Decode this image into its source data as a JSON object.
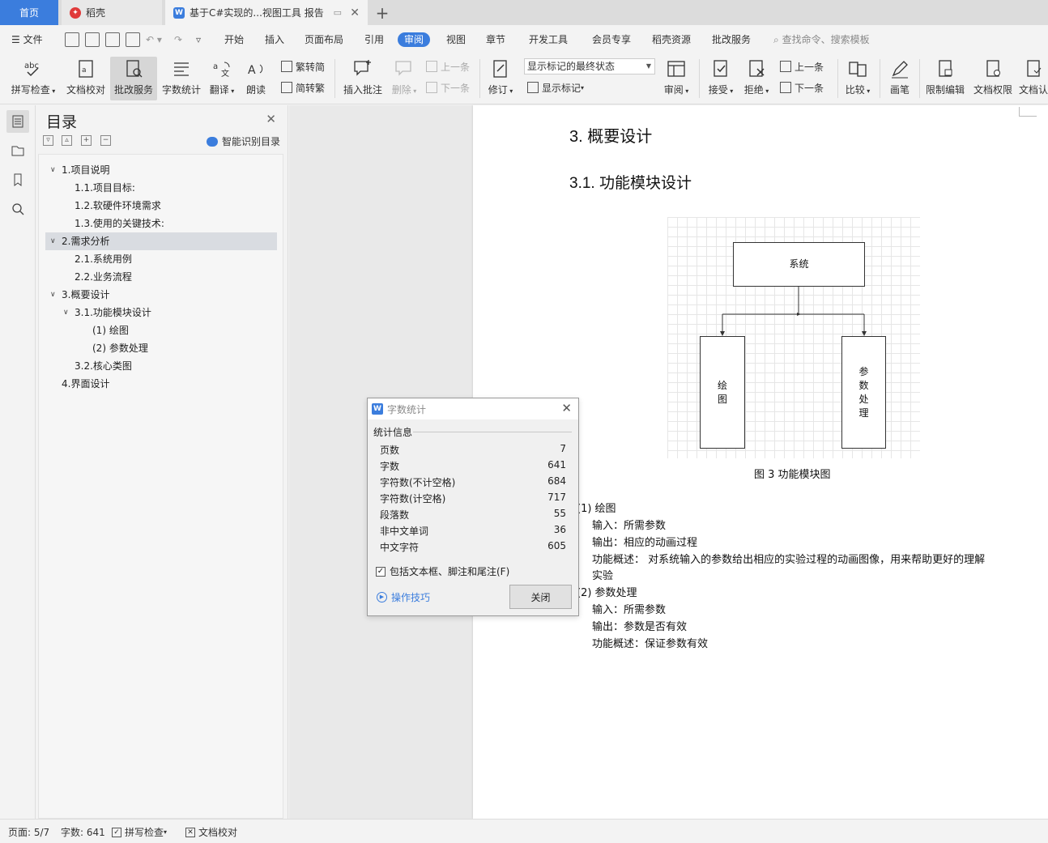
{
  "tabs": {
    "home": "首页",
    "daoke": "稻壳",
    "doc": "基于C#实现的...视图工具 报告"
  },
  "menu": {
    "file": "文件",
    "items": [
      "开始",
      "插入",
      "页面布局",
      "引用",
      "审阅",
      "视图",
      "章节",
      "开发工具",
      "会员专享",
      "稻壳资源",
      "批改服务"
    ],
    "active": "审阅",
    "search": "查找命令、搜索模板"
  },
  "ribbon": {
    "spell": "拼写检查",
    "proofread": "文档校对",
    "correct": "批改服务",
    "wordcount": "字数统计",
    "translate": "翻译",
    "read": "朗读",
    "trad": "繁转简",
    "simp": "简转繁",
    "insert_comment": "插入批注",
    "delete": "删除",
    "prev": "上一条",
    "next": "下一条",
    "revise": "修订",
    "markup_state": "显示标记的最终状态",
    "show_markup": "显示标记",
    "review": "审阅",
    "accept": "接受",
    "reject": "拒绝",
    "prev2": "上一条",
    "next2": "下一条",
    "compare": "比较",
    "pen": "画笔",
    "restrict": "限制编辑",
    "permission": "文档权限",
    "cert": "文档认"
  },
  "toc": {
    "title": "目录",
    "smart": "智能识别目录",
    "items": [
      {
        "label": "1.项目说明"
      },
      {
        "label": "1.1.项目目标:"
      },
      {
        "label": "1.2.软硬件环境需求"
      },
      {
        "label": "1.3.使用的关键技术:"
      },
      {
        "label": "2.需求分析"
      },
      {
        "label": "2.1.系统用例"
      },
      {
        "label": "2.2.业务流程"
      },
      {
        "label": "3.概要设计"
      },
      {
        "label": "3.1.功能模块设计"
      },
      {
        "label": "(1) 绘图"
      },
      {
        "label": "(2) 参数处理"
      },
      {
        "label": "3.2.核心类图"
      },
      {
        "label": "4.界面设计"
      }
    ]
  },
  "doc": {
    "h1": "3.  概要设计",
    "h2": "3.1. 功能模块设计",
    "diagram": {
      "system": "系统",
      "draw": "绘\n图",
      "params": "参\n数\n处\n理"
    },
    "caption": "图 3 功能模块图",
    "lines": [
      "(1)    绘图",
      "输入：所需参数",
      "输出：相应的动画过程",
      "功能概述：  对系统输入的参数给出相应的实验过程的动画图像，用来帮助更好的理解",
      "实验",
      "(2)    参数处理",
      "输入：所需参数",
      "输出：参数是否有效",
      "功能概述：保证参数有效"
    ]
  },
  "dialog": {
    "title": "字数统计",
    "group": "统计信息",
    "stats": [
      {
        "label": "页数",
        "value": "7"
      },
      {
        "label": "字数",
        "value": "641"
      },
      {
        "label": "字符数(不计空格)",
        "value": "684"
      },
      {
        "label": "字符数(计空格)",
        "value": "717"
      },
      {
        "label": "段落数",
        "value": "55"
      },
      {
        "label": "非中文单词",
        "value": "36"
      },
      {
        "label": "中文字符",
        "value": "605"
      }
    ],
    "checkbox": "包括文本框、脚注和尾注(F)",
    "tips": "操作技巧",
    "close": "关闭"
  },
  "status": {
    "page": "页面: 5/7",
    "words": "字数: 641",
    "spell": "拼写检查",
    "proof": "文档校对"
  },
  "colors": {
    "accent": "#3b7ddd",
    "daoke": "#e03a3a"
  }
}
